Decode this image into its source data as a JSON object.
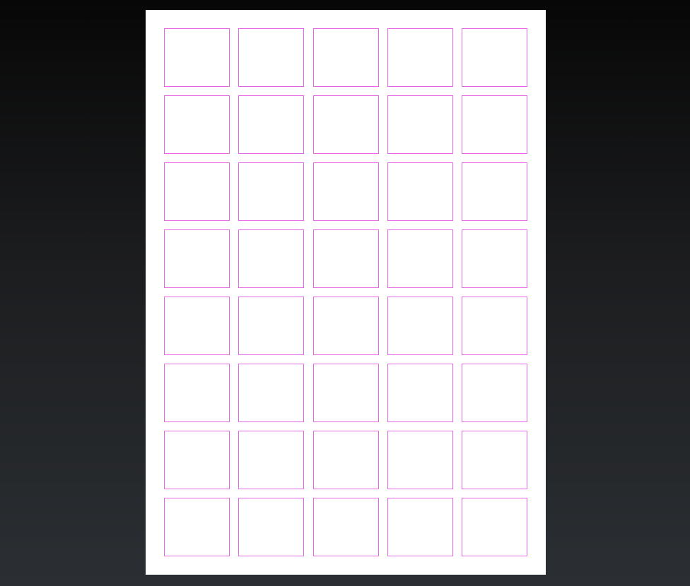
{
  "colors": {
    "sheet_background": "#ffffff",
    "label_outline": "#e566e5"
  },
  "label_sheet": {
    "rows": 8,
    "columns": 5
  }
}
